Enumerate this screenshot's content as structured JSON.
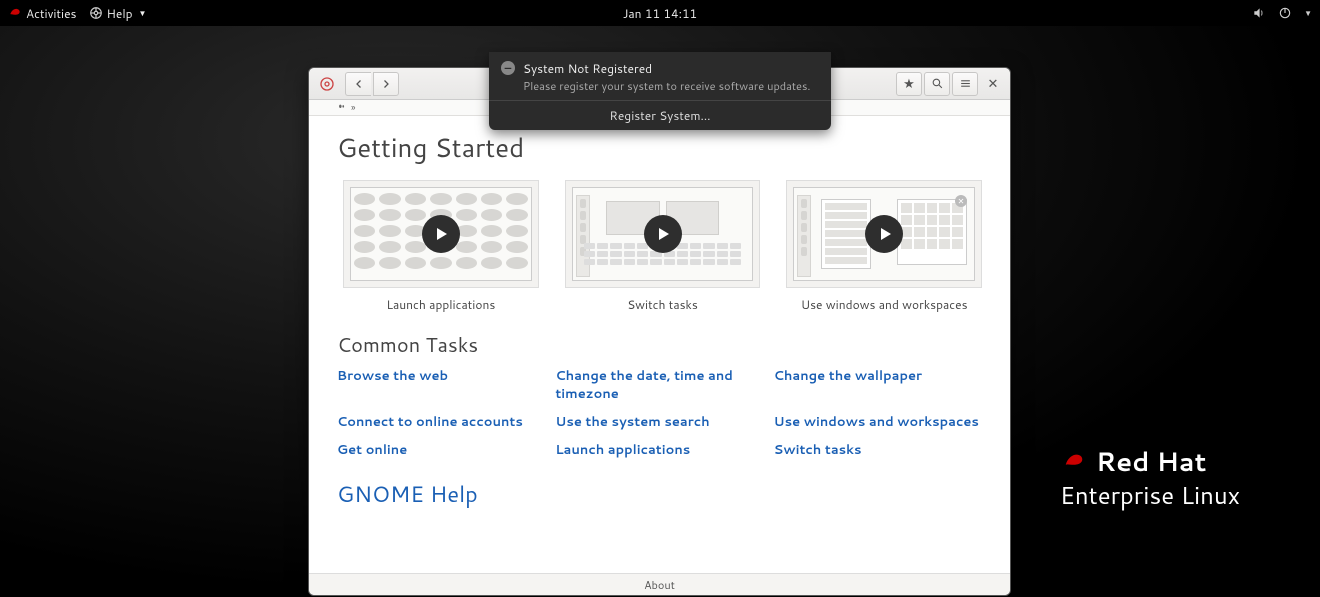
{
  "topbar": {
    "activities": "Activities",
    "help": "Help",
    "datetime": "Jan 11  14:11"
  },
  "notification": {
    "title": "System Not Registered",
    "message": "Please register your system to receive software updates.",
    "action": "Register System…"
  },
  "watermark": {
    "line1": "Red Hat",
    "line2": "Enterprise Linux"
  },
  "window": {
    "breadcrumb_sep": "»",
    "footer": "About"
  },
  "page": {
    "h1": "Getting Started",
    "h2": "Common Tasks",
    "help_link": "GNOME Help",
    "videos": [
      {
        "label": "Launch applications"
      },
      {
        "label": "Switch tasks"
      },
      {
        "label": "Use windows and workspaces"
      }
    ],
    "tasks": {
      "col1": [
        "Browse the web",
        "Connect to online accounts",
        "Get online"
      ],
      "col2": [
        "Change the date, time and timezone",
        "Use the system search",
        "Launch applications"
      ],
      "col3": [
        "Change the wallpaper",
        "Use windows and workspaces",
        "Switch tasks"
      ]
    }
  }
}
